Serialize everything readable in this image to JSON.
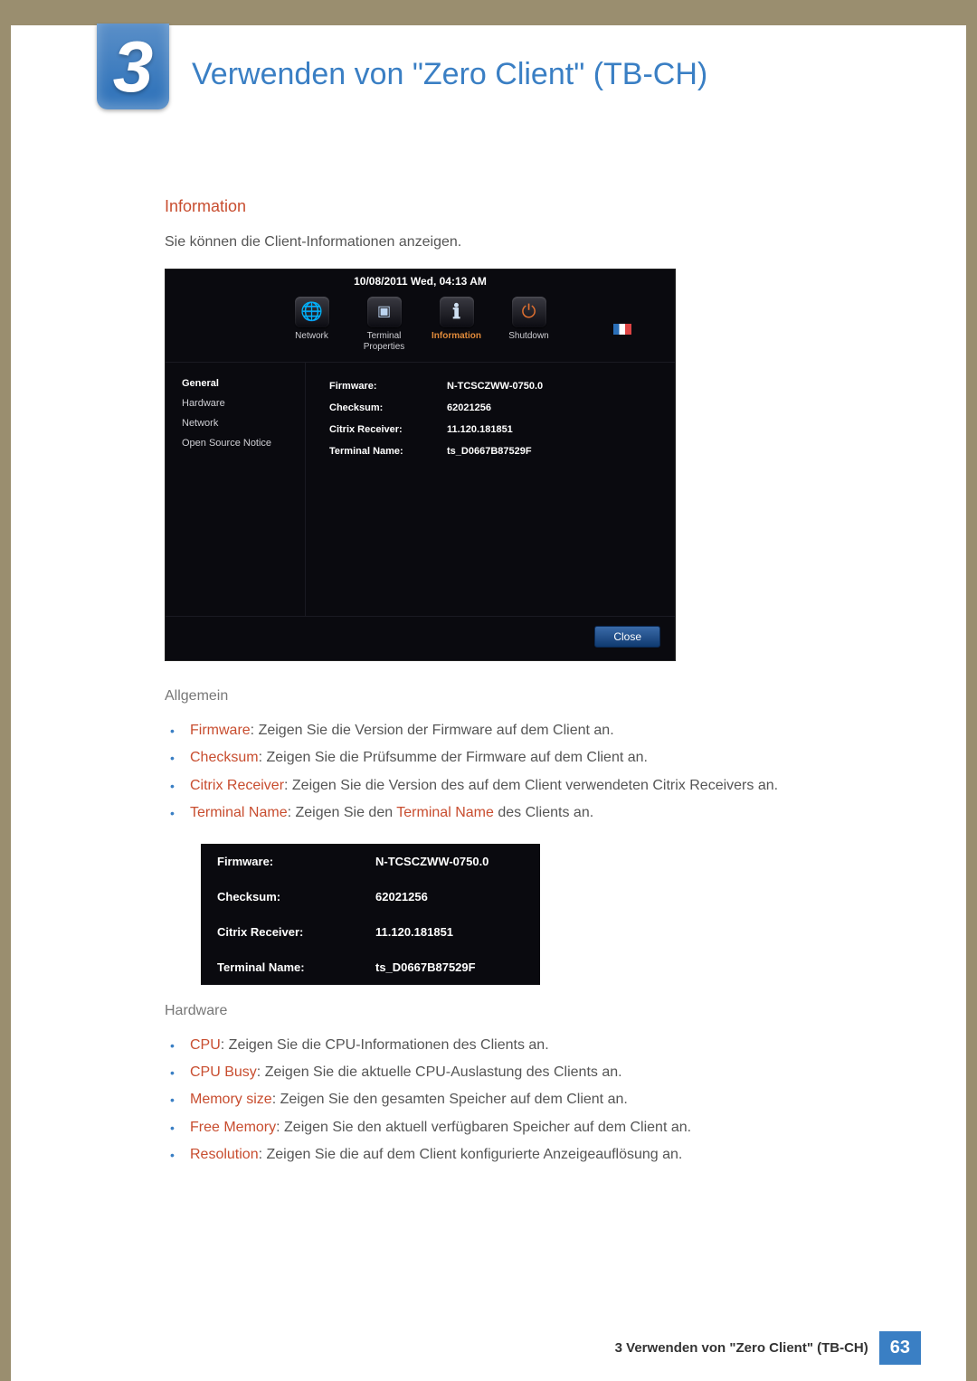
{
  "chapter": {
    "number": "3",
    "title": "Verwenden von \"Zero Client\" (TB-CH)"
  },
  "section": {
    "heading": "Information",
    "intro": "Sie können die Client-Informationen anzeigen."
  },
  "ui": {
    "datetime": "10/08/2011 Wed, 04:13 AM",
    "tabs": [
      {
        "label": "Network",
        "active": false
      },
      {
        "label": "Terminal Properties",
        "active": false
      },
      {
        "label": "Information",
        "active": true
      },
      {
        "label": "Shutdown",
        "active": false
      }
    ],
    "sidebar": [
      {
        "label": "General",
        "active": true
      },
      {
        "label": "Hardware",
        "active": false
      },
      {
        "label": "Network",
        "active": false
      },
      {
        "label": "Open Source Notice",
        "active": false
      }
    ],
    "rows": [
      {
        "label": "Firmware:",
        "value": "N-TCSCZWW-0750.0"
      },
      {
        "label": "Checksum:",
        "value": "62021256"
      },
      {
        "label": "Citrix Receiver:",
        "value": "11.120.181851"
      },
      {
        "label": "Terminal Name:",
        "value": "ts_D0667B87529F"
      }
    ],
    "close_label": "Close"
  },
  "subsections": {
    "general": {
      "heading": "Allgemein",
      "items": [
        {
          "term": "Firmware",
          "desc": ": Zeigen Sie die Version der Firmware auf dem Client an."
        },
        {
          "term": "Checksum",
          "desc": ": Zeigen Sie die Prüfsumme der Firmware auf dem Client an."
        },
        {
          "term": "Citrix Receiver",
          "desc": ": Zeigen Sie die Version des auf dem Client verwendeten Citrix Receivers an."
        },
        {
          "term": "Terminal Name",
          "desc_pre": ": Zeigen Sie den ",
          "desc_mid": "Terminal Name",
          "desc_post": " des Clients an."
        }
      ]
    },
    "table": [
      {
        "label": "Firmware:",
        "value": "N-TCSCZWW-0750.0"
      },
      {
        "label": "Checksum:",
        "value": "62021256"
      },
      {
        "label": "Citrix Receiver:",
        "value": "11.120.181851"
      },
      {
        "label": "Terminal Name:",
        "value": "ts_D0667B87529F"
      }
    ],
    "hardware": {
      "heading": "Hardware",
      "items": [
        {
          "term": "CPU",
          "desc": ": Zeigen Sie die CPU-Informationen des Clients an."
        },
        {
          "term": "CPU Busy",
          "desc": ": Zeigen Sie die aktuelle CPU-Auslastung des Clients an."
        },
        {
          "term": "Memory size",
          "desc": ": Zeigen Sie den gesamten Speicher auf dem Client an."
        },
        {
          "term": "Free Memory",
          "desc": ": Zeigen Sie den aktuell verfügbaren Speicher auf dem Client an."
        },
        {
          "term": "Resolution",
          "desc": ": Zeigen Sie die auf dem Client konfigurierte Anzeigeauflösung an."
        }
      ]
    }
  },
  "footer": {
    "title": "3 Verwenden von \"Zero Client\" (TB-CH)",
    "page": "63"
  },
  "icons": {
    "network_glyph": "🌐",
    "terminal_glyph": "▣",
    "info_glyph": "ℹ",
    "shutdown_glyph": "⏻"
  }
}
